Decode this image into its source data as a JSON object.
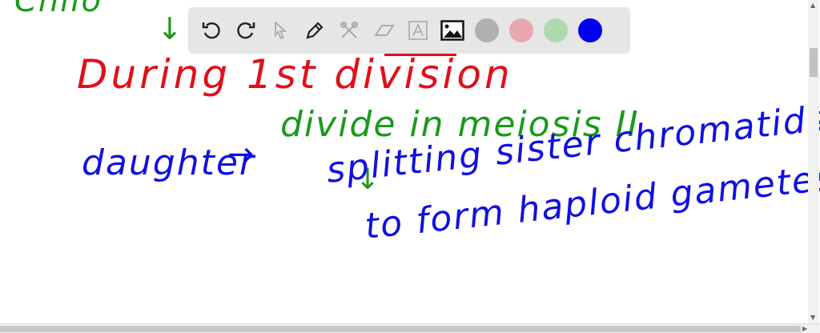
{
  "notes": {
    "top_cut": "Chilo",
    "line1": "During 1st division",
    "line2a": "daughter",
    "line2b": "divide in meiosis II",
    "line3": "splitting sister chromatids",
    "line4": "to form haploid gametes"
  },
  "toolbar": {
    "tools": [
      "undo-icon",
      "redo-icon",
      "select-icon",
      "pen-icon",
      "tools-icon",
      "eraser-icon",
      "text-icon",
      "image-icon"
    ],
    "colors": [
      "#b0b0b0",
      "#e8a8b0",
      "#b0d8b0",
      "#0000ee"
    ]
  }
}
